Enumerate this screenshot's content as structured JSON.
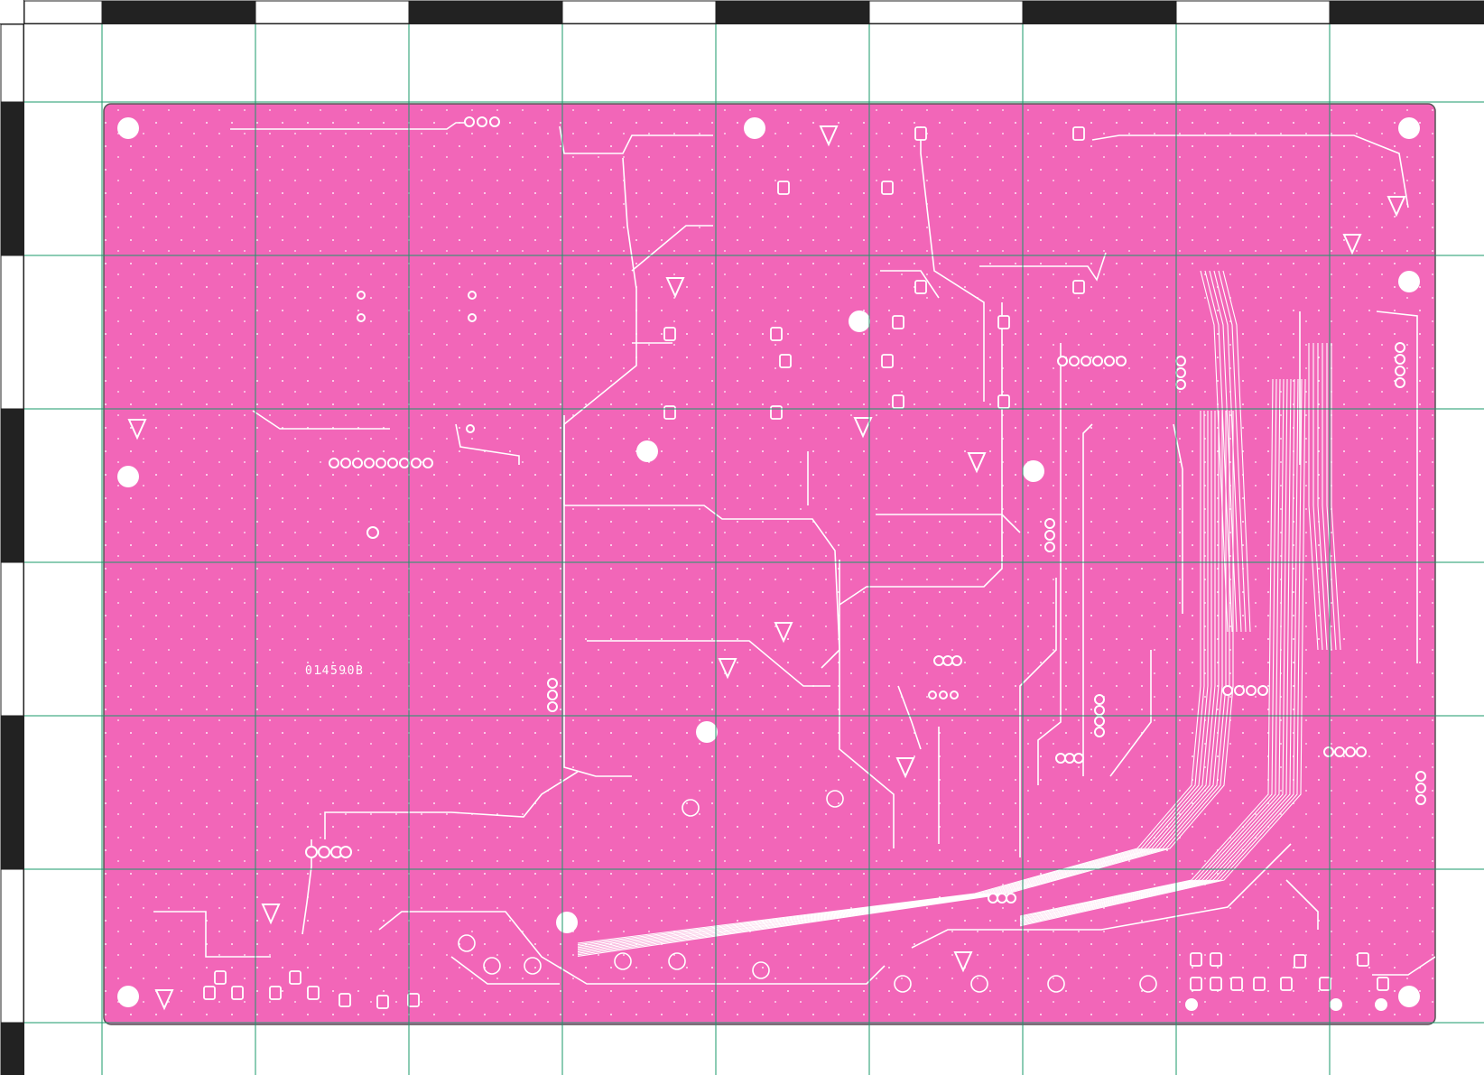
{
  "board": {
    "part_number": "014590B"
  },
  "colors": {
    "copper": "#f266b8",
    "trace": "#ffffff",
    "outline": "#555555",
    "grid_line": "#1a9a6a",
    "ruler_dark": "#222222",
    "ruler_light": "#ffffff",
    "page_bg": "#ffffff"
  },
  "layout_note": {
    "grid_columns": 9,
    "grid_rows": 7
  }
}
